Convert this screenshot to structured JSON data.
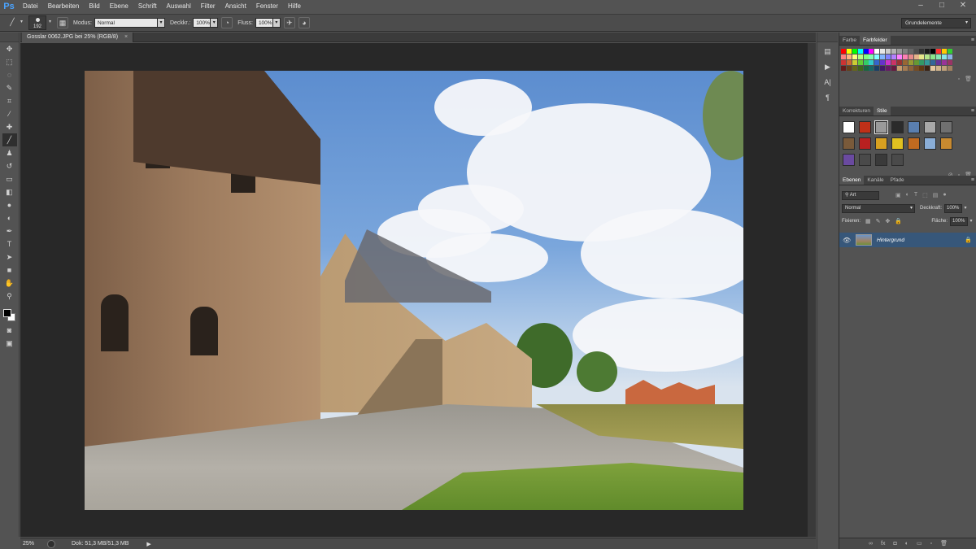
{
  "app": {
    "logo": "Ps"
  },
  "menu": [
    "Datei",
    "Bearbeiten",
    "Bild",
    "Ebene",
    "Schrift",
    "Auswahl",
    "Filter",
    "Ansicht",
    "Fenster",
    "Hilfe"
  ],
  "window_controls": {
    "minimize": "–",
    "maximize": "□",
    "close": "✕"
  },
  "options": {
    "brush_size": "192",
    "mode_label": "Modus:",
    "mode_value": "Normal",
    "opacity_label": "Deckkr.:",
    "opacity_value": "100%",
    "flow_label": "Fluss:",
    "flow_value": "100%",
    "workspace": "Grundelemente"
  },
  "document": {
    "tab_title": "Gosslar 0062.JPG bei 25% (RGB/8)",
    "tab_close": "×",
    "zoom": "25%",
    "doc_info": "Dok: 51,3 MB/51,3 MB",
    "status_arrow": "▶"
  },
  "tools": [
    {
      "name": "move-tool-icon",
      "glyph": "✥"
    },
    {
      "name": "marquee-tool-icon",
      "glyph": "⬚"
    },
    {
      "name": "lasso-tool-icon",
      "glyph": "◌"
    },
    {
      "name": "quick-select-tool-icon",
      "glyph": "✎"
    },
    {
      "name": "crop-tool-icon",
      "glyph": "⌗"
    },
    {
      "name": "eyedropper-tool-icon",
      "glyph": "⁄"
    },
    {
      "name": "healing-brush-tool-icon",
      "glyph": "✚"
    },
    {
      "name": "brush-tool-icon",
      "glyph": "╱"
    },
    {
      "name": "clone-stamp-tool-icon",
      "glyph": "♟"
    },
    {
      "name": "history-brush-tool-icon",
      "glyph": "↺"
    },
    {
      "name": "eraser-tool-icon",
      "glyph": "▭"
    },
    {
      "name": "gradient-tool-icon",
      "glyph": "◧"
    },
    {
      "name": "blur-tool-icon",
      "glyph": "●"
    },
    {
      "name": "dodge-tool-icon",
      "glyph": "◐"
    },
    {
      "name": "pen-tool-icon",
      "glyph": "✒"
    },
    {
      "name": "type-tool-icon",
      "glyph": "T"
    },
    {
      "name": "path-select-tool-icon",
      "glyph": "➤"
    },
    {
      "name": "shape-tool-icon",
      "glyph": "■"
    },
    {
      "name": "hand-tool-icon",
      "glyph": "✋"
    },
    {
      "name": "zoom-tool-icon",
      "glyph": "⚲"
    }
  ],
  "tools_bottom": [
    {
      "name": "quick-mask-icon",
      "glyph": "◙"
    },
    {
      "name": "screen-mode-icon",
      "glyph": "▣"
    }
  ],
  "colors": {
    "foreground": "#000000",
    "background": "#ffffff"
  },
  "dock": [
    {
      "name": "history-panel-icon",
      "glyph": "▤"
    },
    {
      "name": "actions-panel-icon",
      "glyph": "▶"
    },
    {
      "name": "character-panel-icon",
      "glyph": "A|"
    },
    {
      "name": "paragraph-panel-icon",
      "glyph": "¶"
    }
  ],
  "swatches_panel": {
    "tabs": [
      "Farbe",
      "Farbfelder"
    ],
    "active": 1,
    "colors": [
      "#ff0000",
      "#ffff00",
      "#00ff00",
      "#00ffff",
      "#0000ff",
      "#ff00ff",
      "#ffffff",
      "#e6e6e6",
      "#cccccc",
      "#b3b3b3",
      "#999999",
      "#808080",
      "#666666",
      "#4d4d4d",
      "#333333",
      "#1a1a1a",
      "#000000",
      "#ff3333",
      "#ffcc00",
      "#33cc33",
      "#ff8080",
      "#ffb380",
      "#ffff80",
      "#b3ff80",
      "#80ff80",
      "#80ffb3",
      "#80ffff",
      "#80b3ff",
      "#8080ff",
      "#b380ff",
      "#ff80ff",
      "#ff80b3",
      "#e68a8a",
      "#e6b38a",
      "#e6e68a",
      "#b3e68a",
      "#8ae68a",
      "#8ae6b3",
      "#8ae6e6",
      "#8ab3e6",
      "#cc3333",
      "#cc6633",
      "#cccc33",
      "#66cc33",
      "#33cc66",
      "#33cccc",
      "#3366cc",
      "#6633cc",
      "#cc33cc",
      "#cc3366",
      "#993333",
      "#996633",
      "#999933",
      "#669933",
      "#339966",
      "#339999",
      "#336699",
      "#663399",
      "#993399",
      "#993366",
      "#661a1a",
      "#66401a",
      "#66661a",
      "#40661a",
      "#1a6640",
      "#1a6666",
      "#1a4066",
      "#401a66",
      "#661a66",
      "#661a40",
      "#c69c6d",
      "#a67c52",
      "#8c6239",
      "#754c24",
      "#603913",
      "#3c2415",
      "#e6c8a0",
      "#d2b48c",
      "#bfa07a",
      "#a08060"
    ]
  },
  "styles_panel": {
    "tabs": [
      "Korrekturen",
      "Stile"
    ],
    "active": 1,
    "cells": [
      {
        "name": "style-none",
        "color": "#ffffff"
      },
      {
        "name": "style-red-glow",
        "color": "#c03018"
      },
      {
        "name": "style-gray-frame",
        "color": "#9a9a9a"
      },
      {
        "name": "style-dark-gloss",
        "color": "#2b2b2b"
      },
      {
        "name": "style-blue-chrome",
        "color": "#5a7fb0"
      },
      {
        "name": "style-silver",
        "color": "#a8a8a8"
      },
      {
        "name": "style-steel",
        "color": "#707070"
      },
      {
        "name": "style-wood",
        "color": "#7a5a3a"
      },
      {
        "name": "style-red-bevel",
        "color": "#b82020"
      },
      {
        "name": "style-rainbow",
        "color": "#d8a020"
      },
      {
        "name": "style-yellow",
        "color": "#e0c020"
      },
      {
        "name": "style-orange",
        "color": "#c06a20"
      },
      {
        "name": "style-sky",
        "color": "#8aaed8"
      },
      {
        "name": "style-sunset",
        "color": "#c88a30"
      },
      {
        "name": "style-purple",
        "color": "#6a4aa0"
      },
      {
        "name": "style-empty-1",
        "color": "#4a4a4a"
      },
      {
        "name": "style-empty-2",
        "color": "#3a3a3a"
      },
      {
        "name": "style-empty-3",
        "color": "#4a4a4a"
      }
    ],
    "selected": 2
  },
  "layers_panel": {
    "tabs": [
      "Ebenen",
      "Kanäle",
      "Pfade"
    ],
    "active": 0,
    "filter_label": "Art",
    "blend_mode": "Normal",
    "opacity_label": "Deckkraft:",
    "opacity_value": "100%",
    "lock_label": "Fixieren:",
    "fill_label": "Fläche:",
    "fill_value": "100%",
    "layers": [
      {
        "name": "Hintergrund",
        "locked": true
      }
    ]
  }
}
